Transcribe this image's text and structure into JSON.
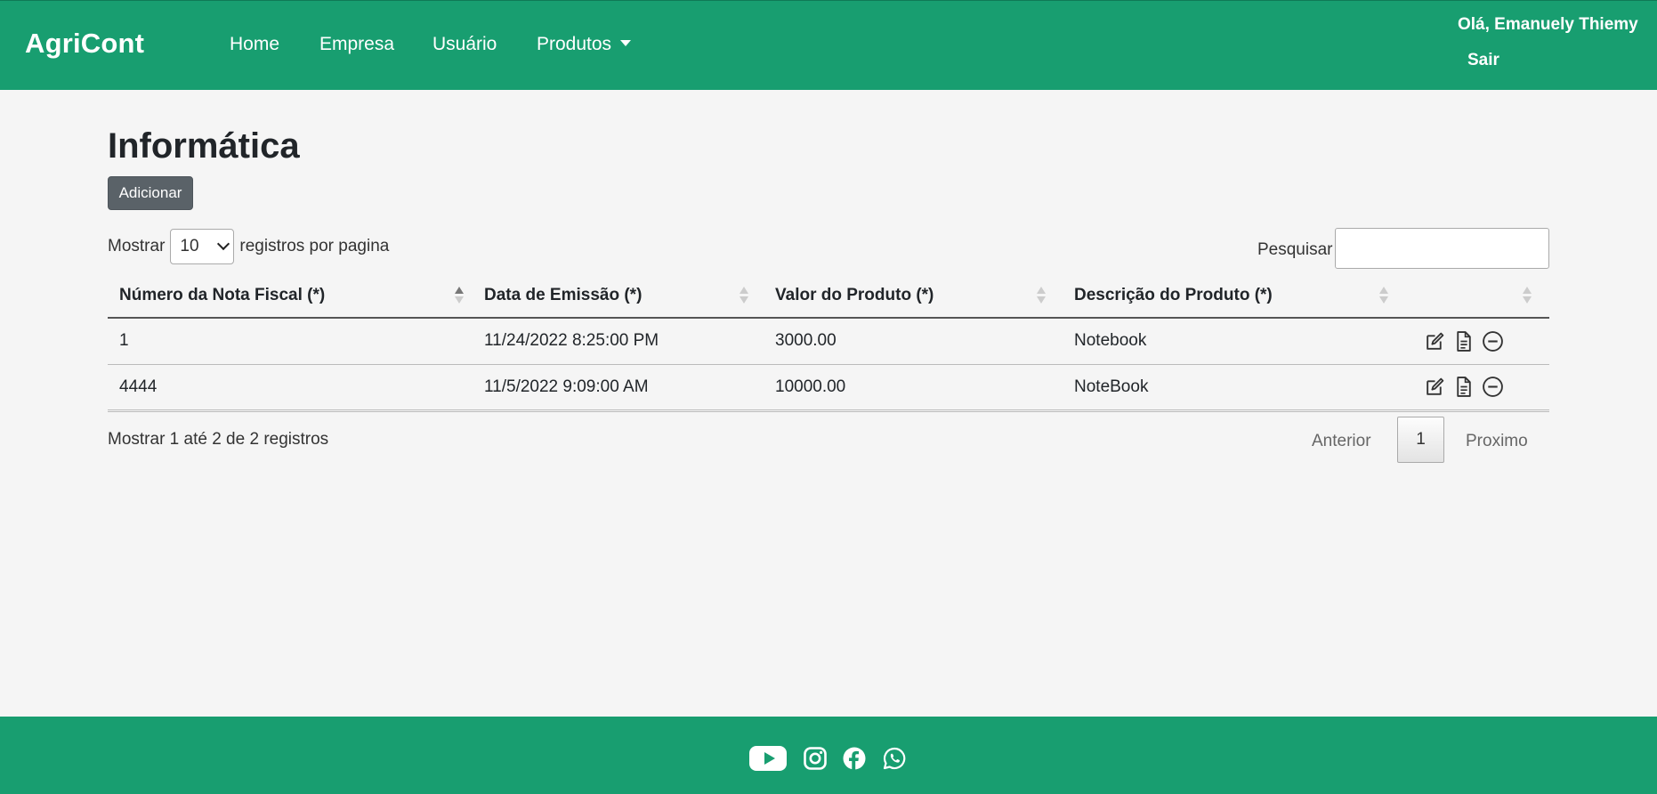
{
  "navbar": {
    "brand": "AgriCont",
    "items": [
      {
        "label": "Home"
      },
      {
        "label": "Empresa"
      },
      {
        "label": "Usuário"
      },
      {
        "label": "Produtos"
      }
    ],
    "greeting": "Olá, Emanuely Thiemy",
    "logout": "Sair",
    "color": "#189e70"
  },
  "main": {
    "title": "Informática",
    "add_button": "Adicionar",
    "length": {
      "prefix": "Mostrar",
      "value": "10",
      "suffix": "registros por pagina"
    },
    "search": {
      "label": "Pesquisar",
      "value": ""
    },
    "table": {
      "columns": [
        "Número da Nota Fiscal (*)",
        "Data de Emissão (*)",
        "Valor do Produto (*)",
        "Descrição do Produto (*)",
        ""
      ],
      "rows": [
        {
          "numero": "1",
          "data": "11/24/2022 8:25:00 PM",
          "valor": "3000.00",
          "descricao": "Notebook"
        },
        {
          "numero": "4444",
          "data": "11/5/2022 9:09:00 AM",
          "valor": "10000.00",
          "descricao": "NoteBook"
        }
      ],
      "row_icons": [
        "edit-icon",
        "document-icon",
        "remove-icon"
      ]
    },
    "info": "Mostrar 1 até 2 de 2 registros",
    "pagination": {
      "previous": "Anterior",
      "current": "1",
      "next": "Proximo"
    }
  },
  "footer": {
    "icons": [
      "youtube-icon",
      "instagram-icon",
      "facebook-icon",
      "whatsapp-icon"
    ]
  }
}
